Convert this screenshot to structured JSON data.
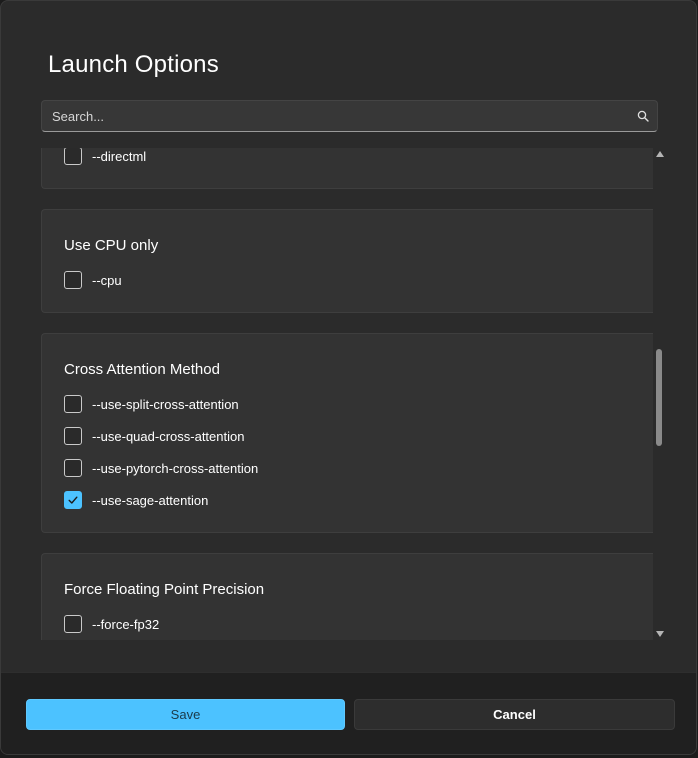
{
  "dialog": {
    "title": "Launch Options"
  },
  "search": {
    "placeholder": "Search..."
  },
  "groups": [
    {
      "title": "",
      "options": [
        {
          "label": "--directml",
          "checked": false
        }
      ]
    },
    {
      "title": "Use CPU only",
      "options": [
        {
          "label": "--cpu",
          "checked": false
        }
      ]
    },
    {
      "title": "Cross Attention Method",
      "options": [
        {
          "label": "--use-split-cross-attention",
          "checked": false
        },
        {
          "label": "--use-quad-cross-attention",
          "checked": false
        },
        {
          "label": "--use-pytorch-cross-attention",
          "checked": false
        },
        {
          "label": "--use-sage-attention",
          "checked": true
        }
      ]
    },
    {
      "title": "Force Floating Point Precision",
      "options": [
        {
          "label": "--force-fp32",
          "checked": false
        }
      ]
    }
  ],
  "footer": {
    "save_label": "Save",
    "cancel_label": "Cancel"
  },
  "colors": {
    "accent": "#4cc2ff",
    "background": "#2b2b2b",
    "card": "#333333",
    "footer": "#202020"
  }
}
